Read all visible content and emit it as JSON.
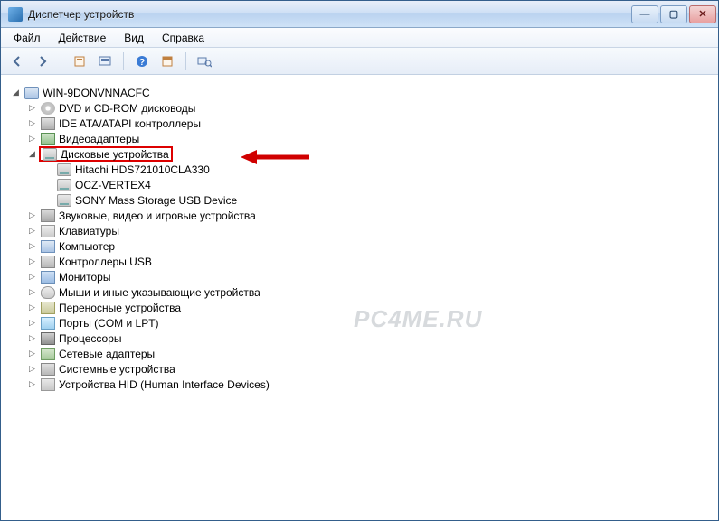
{
  "window": {
    "title": "Диспетчер устройств"
  },
  "menu": {
    "file": "Файл",
    "action": "Действие",
    "view": "Вид",
    "help": "Справка"
  },
  "toolbar_icons": {
    "back": "back-icon",
    "forward": "forward-icon",
    "properties": "properties-icon",
    "console": "console-icon",
    "help": "help-icon",
    "show": "show-icon",
    "scan": "scan-icon"
  },
  "tree": {
    "root": "WIN-9DONVNNACFC",
    "items": [
      {
        "label": "DVD и CD-ROM дисководы",
        "icon": "ic-cd"
      },
      {
        "label": "IDE ATA/ATAPI контроллеры",
        "icon": "ic-ide"
      },
      {
        "label": "Видеоадаптеры",
        "icon": "ic-video"
      },
      {
        "label": "Дисковые устройства",
        "icon": "ic-disk",
        "expanded": true,
        "highlighted": true,
        "children": [
          {
            "label": "Hitachi HDS721010CLA330",
            "icon": "ic-disk"
          },
          {
            "label": "OCZ-VERTEX4",
            "icon": "ic-disk"
          },
          {
            "label": "SONY Mass Storage USB Device",
            "icon": "ic-disk"
          }
        ]
      },
      {
        "label": "Звуковые, видео и игровые устройства",
        "icon": "ic-sound"
      },
      {
        "label": "Клавиатуры",
        "icon": "ic-kb"
      },
      {
        "label": "Компьютер",
        "icon": "ic-comp"
      },
      {
        "label": "Контроллеры USB",
        "icon": "ic-usb"
      },
      {
        "label": "Мониторы",
        "icon": "ic-mon"
      },
      {
        "label": "Мыши и иные указывающие устройства",
        "icon": "ic-mouse"
      },
      {
        "label": "Переносные устройства",
        "icon": "ic-port"
      },
      {
        "label": "Порты (COM и LPT)",
        "icon": "ic-com"
      },
      {
        "label": "Процессоры",
        "icon": "ic-cpu"
      },
      {
        "label": "Сетевые адаптеры",
        "icon": "ic-net"
      },
      {
        "label": "Системные устройства",
        "icon": "ic-sys"
      },
      {
        "label": "Устройства HID (Human Interface Devices)",
        "icon": "ic-hid"
      }
    ]
  },
  "watermark": "PC4ME.RU",
  "annotation": {
    "color": "#d00000"
  }
}
